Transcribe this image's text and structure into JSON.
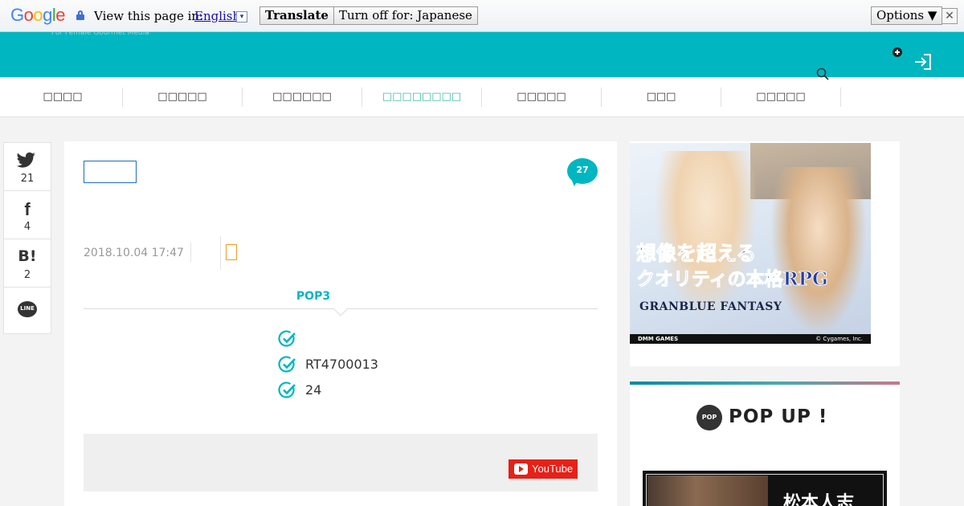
{
  "translate_bar": {
    "logo": {
      "G": "G",
      "o1": "o",
      "o2": "o",
      "g": "g",
      "l": "l",
      "e": "e"
    },
    "view_text": "View this page in:",
    "language": "English",
    "caret": "▾",
    "translate_label": "Translate",
    "turn_off_label": "Turn off for: Japanese",
    "options_label": "Options ▼",
    "close_label": "✕"
  },
  "header": {
    "tagline": "For Female Gourmet Media",
    "icons": [
      "plus-icon",
      "login-icon",
      "search-icon"
    ]
  },
  "nav": {
    "items": [
      {
        "label": "□□□□",
        "active": false
      },
      {
        "label": "□□□□□",
        "active": false
      },
      {
        "label": "□□□□□□",
        "active": false
      },
      {
        "label": "□□□□□□□□",
        "active": true
      },
      {
        "label": "□□□□□",
        "active": false
      },
      {
        "label": "□□□",
        "active": false
      },
      {
        "label": "□□□□□",
        "active": false
      }
    ]
  },
  "share": {
    "twitter": {
      "icon": "twitter-icon",
      "count": "21"
    },
    "facebook": {
      "icon": "facebook-icon",
      "glyph": "f",
      "count": "4"
    },
    "hatena": {
      "icon": "hatena-bookmark-icon",
      "glyph": "B!",
      "count": "2"
    },
    "line": {
      "icon": "line-icon",
      "glyph": "LINE"
    }
  },
  "article": {
    "comment_count": "27",
    "date": "2018.10.04 17:47",
    "bookmark_glyph": "",
    "pop3_label": "POP3",
    "points": [
      "",
      "RT4700013",
      "24"
    ]
  },
  "video": {
    "youtube_label": "YouTube"
  },
  "sidebar": {
    "ad": {
      "copy_line1": "想像を超える",
      "copy_line2": "クオリティの本格RPG",
      "game_logo": "GRANBLUE FANTASY",
      "footer_left": "DMM GAMES",
      "footer_right": "© Cygames, Inc."
    },
    "popup": {
      "badge": "POP",
      "title": "POP UP !",
      "thumb_text": "松本人志"
    }
  },
  "colors": {
    "header_teal": "#00b6c1",
    "nav_active": "#3bb8a6",
    "youtube_red": "#e62117",
    "tag_border": "#1f6fbf"
  }
}
